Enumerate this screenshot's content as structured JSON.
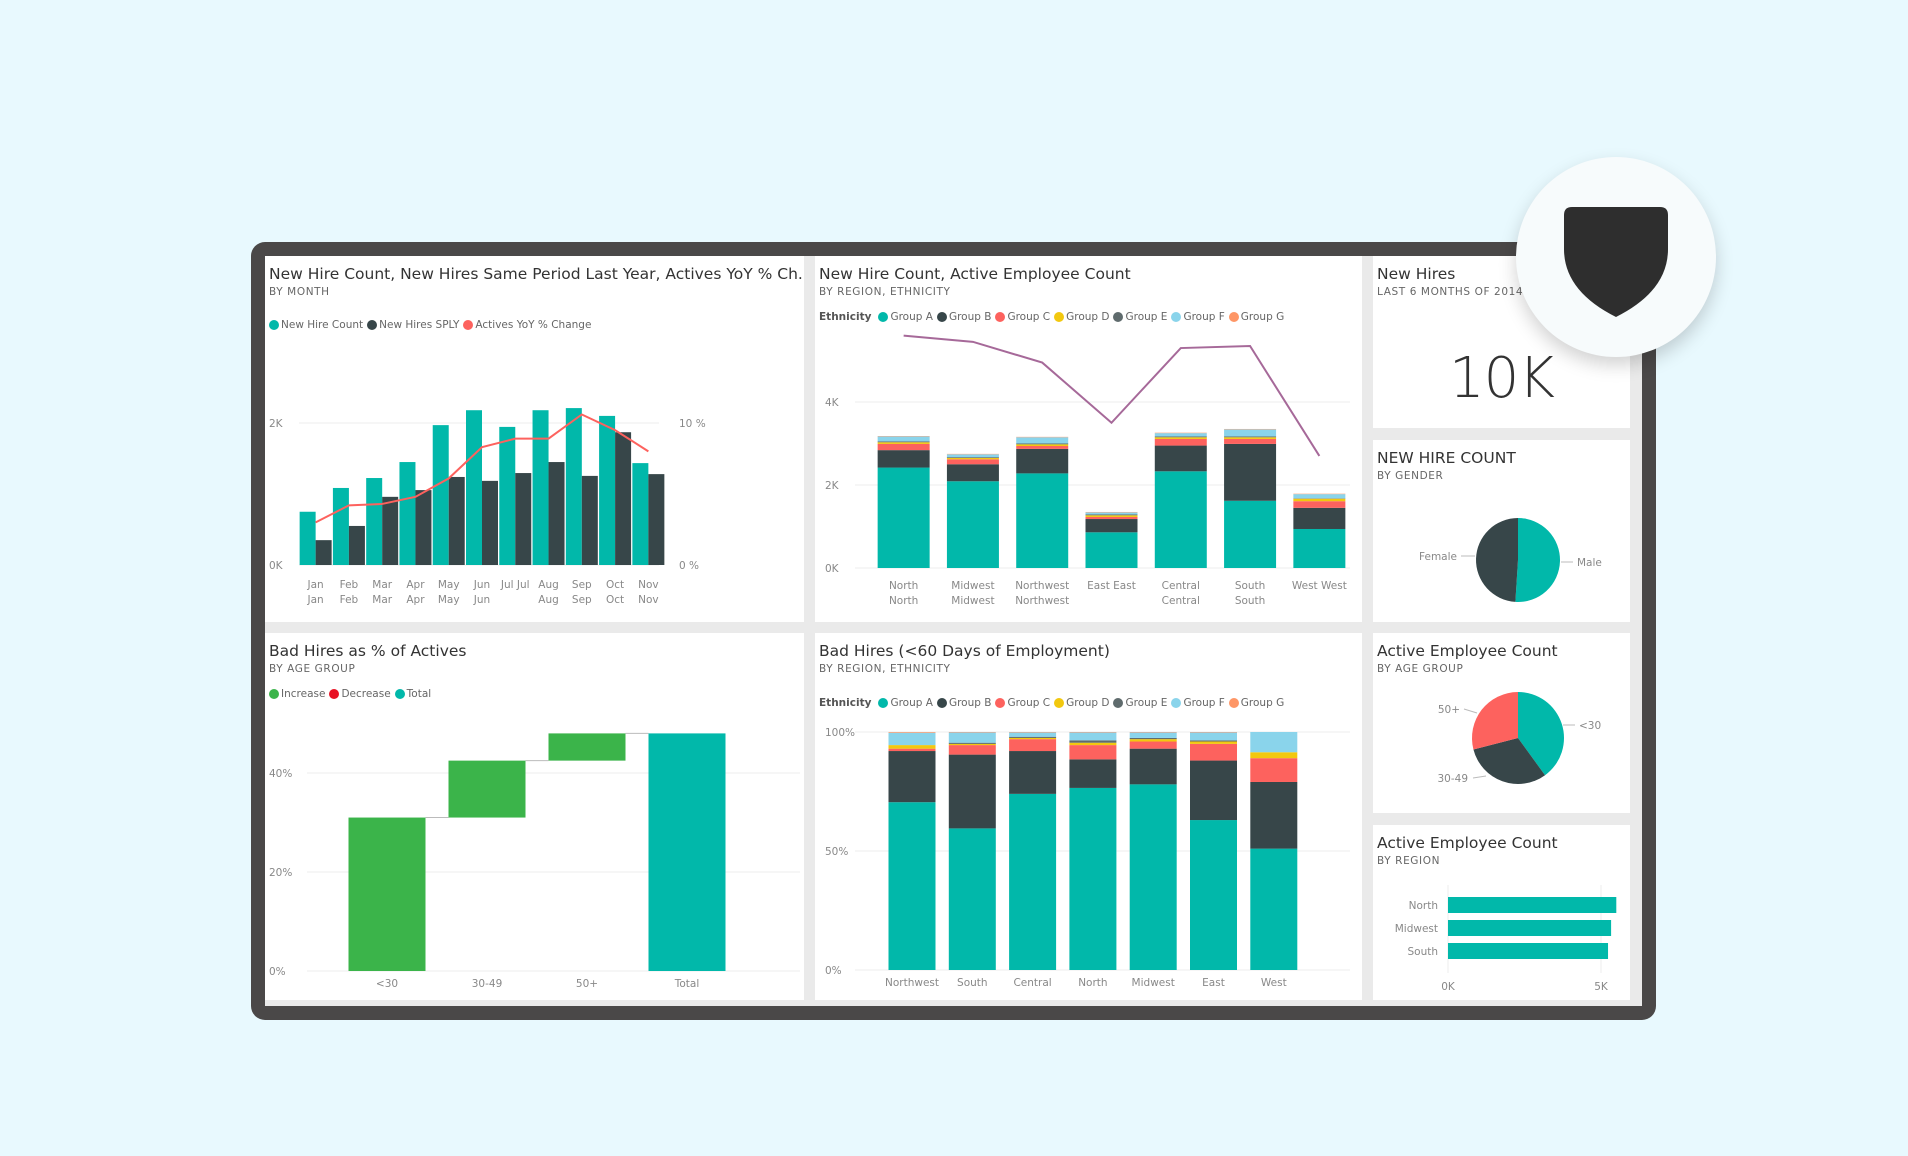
{
  "colors": {
    "teal": "#01b8aa",
    "dark": "#374649",
    "red": "#fd625e",
    "yellow": "#f2c80f",
    "grey": "#5f6b6d",
    "lightblue": "#8ad4eb",
    "orange": "#fe9666",
    "green": "#3bb44a",
    "decrease_red": "#e81123",
    "purple": "#a66999",
    "frame": "#4a4848",
    "background": "#e8f9fe"
  },
  "badge": {
    "icon": "shield-icon"
  },
  "tiles": {
    "hires_by_month": {
      "title": "New Hire Count, New Hires Same Period Last Year, Actives YoY % Ch...",
      "subtitle": "BY MONTH",
      "legend": [
        "New Hire Count",
        "New Hires SPLY",
        "Actives YoY % Change"
      ]
    },
    "hires_by_region": {
      "title": "New Hire Count, Active Employee Count",
      "subtitle": "BY REGION, ETHNICITY",
      "legend_title": "Ethnicity",
      "legend": [
        "Group A",
        "Group B",
        "Group C",
        "Group D",
        "Group E",
        "Group F",
        "Group G"
      ]
    },
    "new_hires_kpi": {
      "title": "New Hires",
      "subtitle": "LAST 6 MONTHS OF 2014",
      "value": "10K"
    },
    "gender": {
      "title": "NEW HIRE COUNT",
      "subtitle": "BY GENDER"
    },
    "bad_hires_age": {
      "title": "Bad Hires as % of Actives",
      "subtitle": "BY AGE GROUP",
      "legend": [
        "Increase",
        "Decrease",
        "Total"
      ]
    },
    "bad_hires_region": {
      "title": "Bad Hires (<60 Days of Employment)",
      "subtitle": "BY REGION, ETHNICITY",
      "legend_title": "Ethnicity",
      "legend": [
        "Group A",
        "Group B",
        "Group C",
        "Group D",
        "Group E",
        "Group F",
        "Group G"
      ]
    },
    "active_age": {
      "title": "Active Employee Count",
      "subtitle": "BY AGE GROUP"
    },
    "active_region": {
      "title": "Active Employee Count",
      "subtitle": "BY REGION"
    }
  },
  "chart_data": [
    {
      "id": "hires_by_month",
      "type": "bar",
      "categories": [
        "Jan Jan",
        "Feb Feb",
        "Mar Mar",
        "Apr Apr",
        "May May",
        "Jun Jun",
        "Jul Jul",
        "Aug Aug",
        "Sep Sep",
        "Oct Oct",
        "Nov Nov"
      ],
      "category_lines": [
        [
          "Jan",
          "Jan"
        ],
        [
          "Feb",
          "Feb"
        ],
        [
          "Mar",
          "Mar"
        ],
        [
          "Apr",
          "Apr"
        ],
        [
          "May",
          "May"
        ],
        [
          "Jun",
          "Jun"
        ],
        [
          "Jul Jul"
        ],
        [
          "Aug",
          "Aug"
        ],
        [
          "Sep",
          "Sep"
        ],
        [
          "Oct",
          "Oct"
        ],
        [
          "Nov",
          "Nov"
        ]
      ],
      "series": [
        {
          "name": "New Hire Count",
          "type": "bar",
          "axis": "left",
          "values": [
            750,
            1085,
            1225,
            1450,
            1970,
            2180,
            1945,
            2180,
            2210,
            2100,
            1435
          ]
        },
        {
          "name": "New Hires SPLY",
          "type": "bar",
          "axis": "left",
          "values": [
            350,
            550,
            960,
            1055,
            1240,
            1185,
            1295,
            1450,
            1255,
            1870,
            1280
          ]
        },
        {
          "name": "Actives YoY % Change",
          "type": "line",
          "axis": "right",
          "values": [
            3.0,
            4.2,
            4.3,
            4.8,
            6.1,
            8.3,
            8.9,
            8.9,
            10.6,
            9.5,
            8.0
          ]
        }
      ],
      "y_ticks": [
        "0K",
        "2K"
      ],
      "y2_ticks": [
        "0 %",
        "10 %"
      ],
      "ylim": [
        0,
        2000
      ],
      "y2lim": [
        0,
        10
      ],
      "grid": true,
      "legend": "top-left"
    },
    {
      "id": "hires_by_region",
      "type": "bar",
      "stacked": true,
      "categories": [
        "North North",
        "Midwest Midwest",
        "Northwest Northwest",
        "East East",
        "Central Central",
        "South South",
        "West West"
      ],
      "category_lines": [
        [
          "North",
          "North"
        ],
        [
          "Midwest",
          "Midwest"
        ],
        [
          "Northwest",
          "Northwest"
        ],
        [
          "East East"
        ],
        [
          "Central",
          "Central"
        ],
        [
          "South",
          "South"
        ],
        [
          "West West"
        ]
      ],
      "series": [
        {
          "name": "Group A",
          "values": [
            2420,
            2090,
            2280,
            860,
            2330,
            1620,
            940
          ]
        },
        {
          "name": "Group B",
          "values": [
            420,
            410,
            590,
            320,
            620,
            1370,
            510
          ]
        },
        {
          "name": "Group C",
          "values": [
            150,
            120,
            70,
            50,
            160,
            120,
            160
          ]
        },
        {
          "name": "Group D",
          "values": [
            40,
            30,
            40,
            40,
            40,
            40,
            60
          ]
        },
        {
          "name": "Group E",
          "values": [
            20,
            20,
            20,
            20,
            20,
            20,
            10
          ]
        },
        {
          "name": "Group F",
          "values": [
            120,
            70,
            150,
            50,
            80,
            170,
            100
          ]
        },
        {
          "name": "Group G",
          "values": [
            10,
            10,
            10,
            10,
            10,
            10,
            10
          ]
        },
        {
          "name": "Active Employee Count",
          "type": "line",
          "values": [
            5600,
            5450,
            4950,
            3500,
            5300,
            5350,
            2700
          ]
        }
      ],
      "y_ticks": [
        "0K",
        "2K",
        "4K"
      ],
      "ylim": [
        0,
        5800
      ],
      "grid": true,
      "legend": "top-left"
    },
    {
      "id": "gender",
      "type": "pie",
      "labels": [
        "Male",
        "Female"
      ],
      "values": [
        51,
        49
      ]
    },
    {
      "id": "bad_hires_age",
      "type": "bar",
      "subtype": "waterfall",
      "categories": [
        "<30",
        "30-49",
        "50+",
        "Total"
      ],
      "values": [
        31,
        11.5,
        5.5,
        48
      ],
      "kinds": [
        "increase",
        "increase",
        "increase",
        "total"
      ],
      "y_ticks": [
        "0%",
        "20%",
        "40%"
      ],
      "ylim": [
        0,
        48
      ],
      "grid": true,
      "legend": "top-left"
    },
    {
      "id": "bad_hires_region",
      "type": "bar",
      "stacked": true,
      "percent": true,
      "categories": [
        "Northwest",
        "South",
        "Central",
        "North",
        "Midwest",
        "East",
        "West"
      ],
      "series": [
        {
          "name": "Group A",
          "values": [
            70.5,
            59.5,
            74,
            76.5,
            78,
            63,
            51
          ]
        },
        {
          "name": "Group B",
          "values": [
            21.5,
            31,
            18,
            12,
            15,
            25,
            28
          ]
        },
        {
          "name": "Group C",
          "values": [
            1,
            4,
            5,
            6,
            3,
            7,
            10
          ]
        },
        {
          "name": "Group D",
          "values": [
            1.5,
            0.5,
            0.5,
            1,
            1,
            1,
            2.5
          ]
        },
        {
          "name": "Group E",
          "values": [
            0,
            0.5,
            0.5,
            1,
            0.5,
            0.5,
            0
          ]
        },
        {
          "name": "Group F",
          "values": [
            5.2,
            4.3,
            1.8,
            3.3,
            2.3,
            3.3,
            8.5
          ]
        },
        {
          "name": "Group G",
          "values": [
            0.3,
            0.2,
            0.2,
            0.2,
            0.2,
            0.2,
            0
          ]
        }
      ],
      "y_ticks": [
        "0%",
        "50%",
        "100%"
      ],
      "ylim": [
        0,
        100
      ],
      "grid": true,
      "legend": "top-left"
    },
    {
      "id": "active_age",
      "type": "pie",
      "labels": [
        "<30",
        "30-49",
        "50+"
      ],
      "values": [
        40,
        31,
        29
      ]
    },
    {
      "id": "active_region",
      "type": "bar",
      "orientation": "horizontal",
      "categories": [
        "North",
        "Midwest",
        "South"
      ],
      "values": [
        5500,
        5330,
        5230
      ],
      "x_ticks": [
        "0K",
        "5K"
      ],
      "xlim": [
        0,
        5000
      ]
    }
  ]
}
